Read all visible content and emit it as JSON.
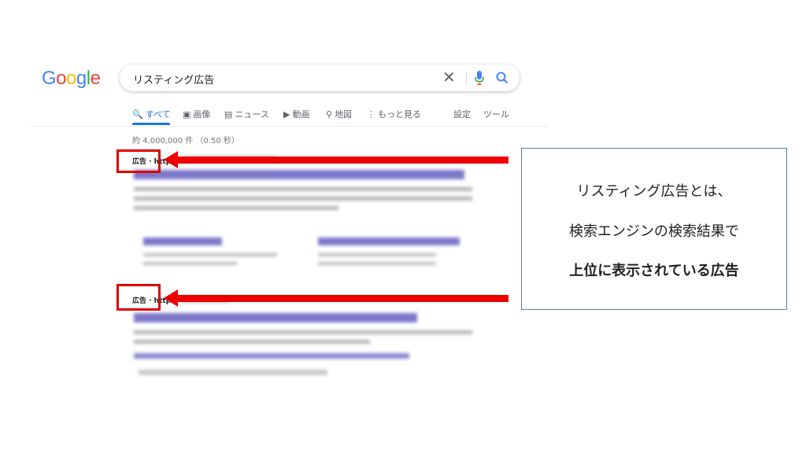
{
  "logo": {
    "letters": [
      "G",
      "o",
      "o",
      "g",
      "l",
      "e"
    ],
    "colors": [
      "#4285f4",
      "#ea4335",
      "#fbbc05",
      "#4285f4",
      "#34a853",
      "#ea4335"
    ]
  },
  "search": {
    "query": "リスティング広告"
  },
  "icons": {
    "clear": "close-icon",
    "mic": "mic-icon",
    "search": "search-icon"
  },
  "tabs": [
    {
      "label": "すべて",
      "icon": "🔍"
    },
    {
      "label": "画像",
      "icon": "▣"
    },
    {
      "label": "ニュース",
      "icon": "▤"
    },
    {
      "label": "動画",
      "icon": "▶"
    },
    {
      "label": "地図",
      "icon": "⚲"
    },
    {
      "label": "もっと見る",
      "icon": "⋮"
    },
    {
      "label": "設定",
      "icon": ""
    },
    {
      "label": "ツール",
      "icon": ""
    }
  ],
  "stats": "約 4,000,000 件 （0.50 秒）",
  "ads": [
    {
      "label": "広告 · http",
      "title": "",
      "desc": "",
      "sitelinks": []
    },
    {
      "label": "広告 · http",
      "title": "",
      "desc": "",
      "links": ""
    }
  ],
  "info": {
    "line1": "リスティング広告とは、",
    "line2": "検索エンジンの検索結果で",
    "line3": "上位に表示されている広告"
  },
  "colors": {
    "accent": "#1a73e8",
    "highlight_red": "#e00000",
    "link": "#1a0dab",
    "box_border": "#5b7fa3"
  }
}
